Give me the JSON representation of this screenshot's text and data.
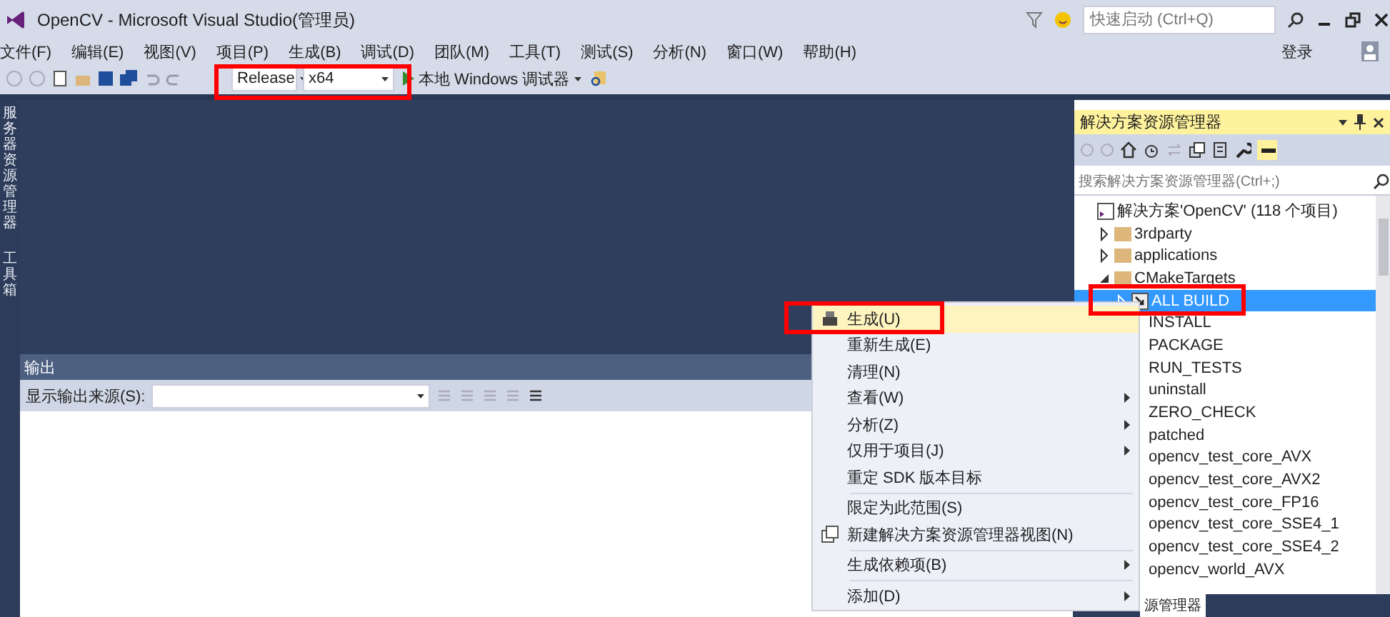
{
  "window": {
    "title": "OpenCV - Microsoft Visual Studio(管理员)",
    "quick_launch": {
      "placeholder": "快速启动 (Ctrl+Q)"
    },
    "sign_in": "登录"
  },
  "menu_bar": [
    "文件(F)",
    "编辑(E)",
    "视图(V)",
    "项目(P)",
    "生成(B)",
    "调试(D)",
    "团队(M)",
    "工具(T)",
    "测试(S)",
    "分析(N)",
    "窗口(W)",
    "帮助(H)"
  ],
  "toolbar": {
    "configuration": "Release",
    "platform": "x64",
    "debugger": "本地 Windows 调试器"
  },
  "side_tabs": [
    "服务器资源管理器",
    "工具箱"
  ],
  "output": {
    "title": "输出",
    "source_label": "显示输出来源(S):"
  },
  "solution_explorer": {
    "title": "解决方案资源管理器",
    "search": {
      "placeholder": "搜索解决方案资源管理器(Ctrl+;)"
    },
    "tree": [
      {
        "label": "解决方案'OpenCV' (118 个项目)",
        "kind": "solution",
        "selected": false,
        "children": [
          {
            "label": "3rdparty",
            "kind": "folder",
            "expanded": false,
            "selected": false
          },
          {
            "label": "applications",
            "kind": "folder",
            "expanded": false,
            "selected": false
          },
          {
            "label": "CMakeTargets",
            "kind": "folder",
            "expanded": true,
            "selected": false,
            "children": [
              {
                "label": "ALL BUILD",
                "kind": "project",
                "expanded": false,
                "selected": true
              },
              {
                "label": "INSTALL",
                "kind": "hidden",
                "selected": false
              },
              {
                "label": "PACKAGE",
                "kind": "hidden",
                "selected": false
              },
              {
                "label": "RUN_TESTS",
                "kind": "hidden",
                "selected": false
              },
              {
                "label": "uninstall",
                "kind": "hidden",
                "selected": false
              },
              {
                "label": "ZERO_CHECK",
                "kind": "hidden",
                "selected": false
              },
              {
                "label": "patched",
                "kind": "hidden",
                "selected": false
              },
              {
                "label": "opencv_test_core_AVX",
                "kind": "hidden",
                "selected": false
              },
              {
                "label": "opencv_test_core_AVX2",
                "kind": "hidden",
                "selected": false
              },
              {
                "label": "opencv_test_core_FP16",
                "kind": "hidden",
                "selected": false
              },
              {
                "label": "opencv_test_core_SSE4_1",
                "kind": "hidden",
                "selected": false
              },
              {
                "label": "opencv_test_core_SSE4_2",
                "kind": "hidden",
                "selected": false
              },
              {
                "label": "opencv_world_AVX",
                "kind": "hidden",
                "selected": false
              }
            ]
          }
        ]
      }
    ],
    "bottom_tabs": [
      "源管理器"
    ]
  },
  "context_menu": [
    {
      "items": [
        {
          "label": "生成(U)",
          "kind": "build",
          "submenu": false,
          "selected": true
        },
        {
          "label": "重新生成(E)",
          "kind": "plain",
          "submenu": false,
          "selected": false
        },
        {
          "label": "清理(N)",
          "kind": "plain",
          "submenu": false,
          "selected": false
        },
        {
          "label": "查看(W)",
          "kind": "plain",
          "submenu": true,
          "selected": false
        },
        {
          "label": "分析(Z)",
          "kind": "plain",
          "submenu": true,
          "selected": false
        },
        {
          "label": "仅用于项目(J)",
          "kind": "plain",
          "submenu": true,
          "selected": false
        },
        {
          "label": "重定 SDK 版本目标",
          "kind": "plain",
          "submenu": false,
          "selected": false
        }
      ]
    },
    {
      "items": [
        {
          "label": "限定为此范围(S)",
          "kind": "plain",
          "submenu": false,
          "selected": false
        },
        {
          "label": "新建解决方案资源管理器视图(N)",
          "kind": "views",
          "submenu": false,
          "selected": false
        }
      ]
    },
    {
      "items": [
        {
          "label": "生成依赖项(B)",
          "kind": "plain",
          "submenu": true,
          "selected": false
        }
      ]
    },
    {
      "items": [
        {
          "label": "添加(D)",
          "kind": "plain",
          "submenu": true,
          "selected": false
        }
      ]
    }
  ]
}
